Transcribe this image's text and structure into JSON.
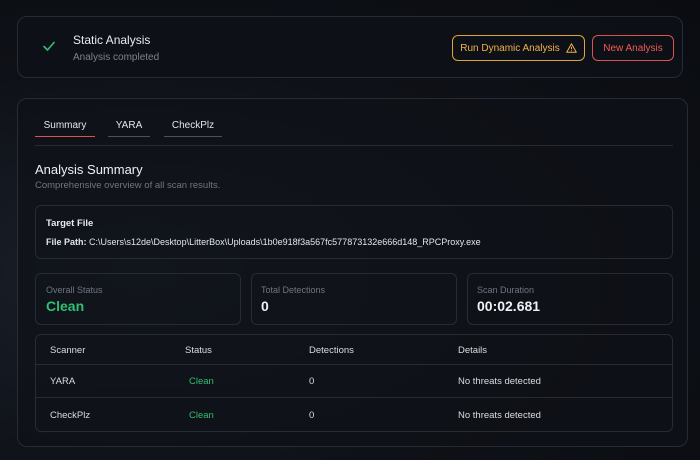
{
  "step": {
    "title": "Static Analysis",
    "subtitle": "Analysis completed",
    "icon": "check-icon"
  },
  "actions": {
    "dynamic_label": "Run Dynamic Analysis",
    "dynamic_icon": "warning-icon",
    "new_label": "New Analysis"
  },
  "tabs": [
    {
      "label": "Summary",
      "active": true
    },
    {
      "label": "YARA",
      "active": false
    },
    {
      "label": "CheckPlz",
      "active": false
    }
  ],
  "summary": {
    "title": "Analysis Summary",
    "subtitle": "Comprehensive overview of all scan results."
  },
  "target": {
    "label": "Target File",
    "path_label": "File Path:",
    "path": "C:\\Users\\s12de\\Desktop\\LitterBox\\Uploads\\1b0e918f3a567fc577873132e666d148_RPCProxy.exe"
  },
  "stats": {
    "overall_status": {
      "label": "Overall Status",
      "value": "Clean"
    },
    "total_detections": {
      "label": "Total Detections",
      "value": "0"
    },
    "scan_duration": {
      "label": "Scan Duration",
      "value": "00:02.681"
    }
  },
  "table": {
    "headers": [
      "Scanner",
      "Status",
      "Detections",
      "Details"
    ],
    "rows": [
      [
        "YARA",
        "Clean",
        "0",
        "No threats detected"
      ],
      [
        "CheckPlz",
        "Clean",
        "0",
        "No threats detected"
      ]
    ]
  },
  "colors": {
    "clean": "#2fbf71",
    "warning": "#f1b24a",
    "danger": "#ef5c56"
  }
}
